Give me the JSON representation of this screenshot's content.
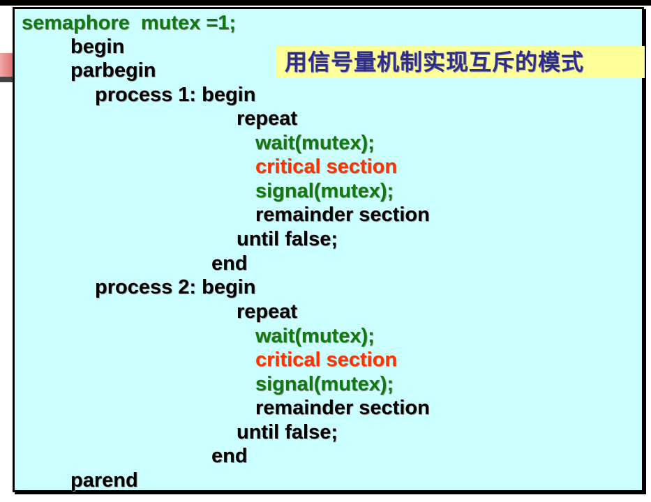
{
  "title_banner": "用信号量机制实现互斥的模式",
  "colors": {
    "box_background": "#ccffff",
    "banner_background": "#ffff99",
    "banner_text": "#2e2e8a",
    "green_code": "#107a10",
    "red_code": "#ff3300"
  },
  "code_lines": [
    "semaphore  mutex =1;",
    "begin",
    "parbegin",
    "process 1: begin",
    "repeat",
    "wait(mutex);",
    "critical section",
    "signal(mutex);",
    "remainder section",
    "until false;",
    "end",
    "process 2: begin",
    "repeat",
    "wait(mutex);",
    "critical section",
    "signal(mutex);",
    "remainder section",
    "until false;",
    "end",
    "parend"
  ]
}
